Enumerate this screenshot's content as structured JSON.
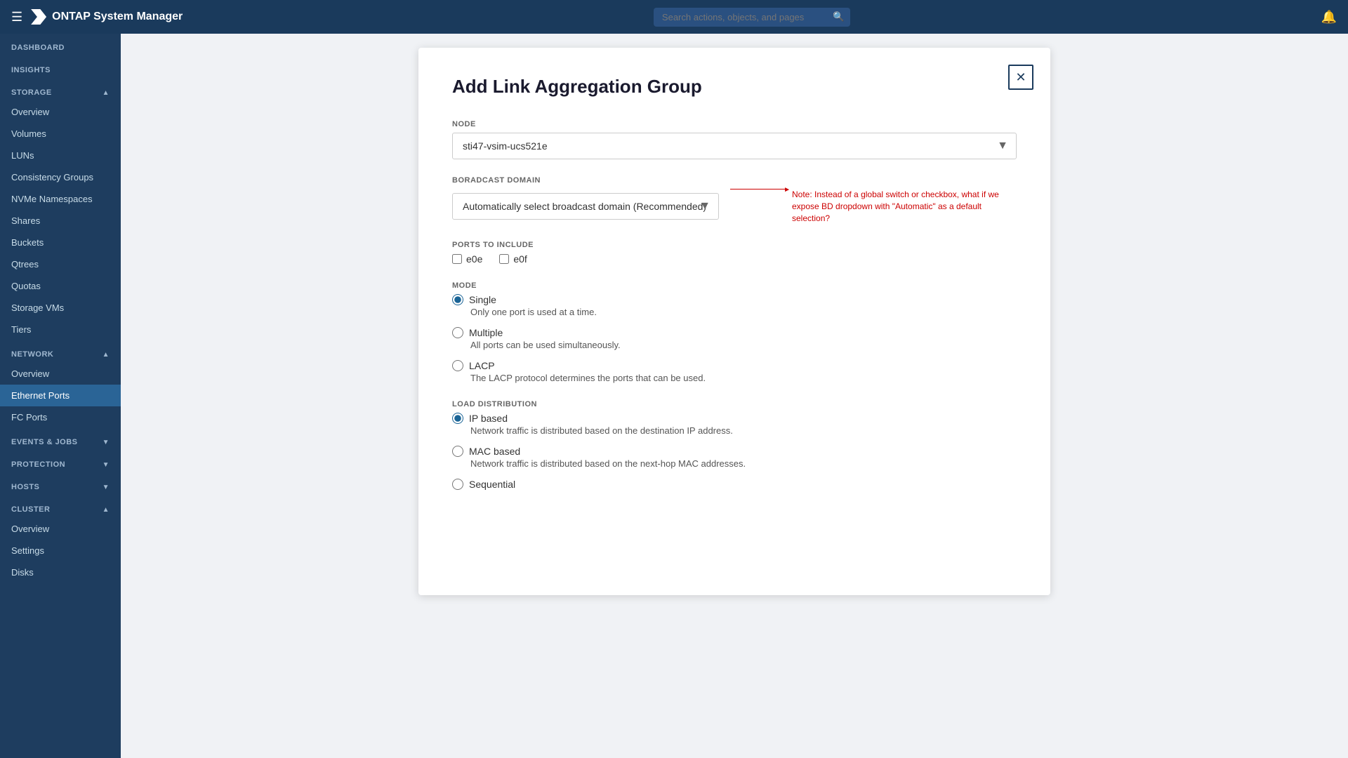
{
  "navbar": {
    "title": "ONTAP System Manager",
    "search_placeholder": "Search actions, objects, and pages"
  },
  "sidebar": {
    "sections": [
      {
        "id": "dashboard",
        "label": "DASHBOARD",
        "type": "top-link",
        "active": false
      },
      {
        "id": "insights",
        "label": "INSIGHTS",
        "type": "top-link",
        "active": false
      },
      {
        "id": "storage",
        "label": "STORAGE",
        "type": "section",
        "expanded": true,
        "items": [
          {
            "id": "overview-storage",
            "label": "Overview",
            "active": false
          },
          {
            "id": "volumes",
            "label": "Volumes",
            "active": false
          },
          {
            "id": "luns",
            "label": "LUNs",
            "active": false
          },
          {
            "id": "consistency-groups",
            "label": "Consistency Groups",
            "active": false
          },
          {
            "id": "nvme-namespaces",
            "label": "NVMe Namespaces",
            "active": false
          },
          {
            "id": "shares",
            "label": "Shares",
            "active": false
          },
          {
            "id": "buckets",
            "label": "Buckets",
            "active": false
          },
          {
            "id": "qtrees",
            "label": "Qtrees",
            "active": false
          },
          {
            "id": "quotas",
            "label": "Quotas",
            "active": false
          },
          {
            "id": "storage-vms",
            "label": "Storage VMs",
            "active": false
          },
          {
            "id": "tiers",
            "label": "Tiers",
            "active": false
          }
        ]
      },
      {
        "id": "network",
        "label": "NETWORK",
        "type": "section",
        "expanded": true,
        "items": [
          {
            "id": "overview-network",
            "label": "Overview",
            "active": false
          },
          {
            "id": "ethernet-ports",
            "label": "Ethernet Ports",
            "active": true
          },
          {
            "id": "fc-ports",
            "label": "FC Ports",
            "active": false
          }
        ]
      },
      {
        "id": "events-jobs",
        "label": "EVENTS & JOBS",
        "type": "section",
        "expanded": true,
        "items": []
      },
      {
        "id": "protection",
        "label": "PROTECTION",
        "type": "section",
        "expanded": true,
        "items": []
      },
      {
        "id": "hosts",
        "label": "HOSTS",
        "type": "section",
        "expanded": true,
        "items": []
      },
      {
        "id": "cluster",
        "label": "CLUSTER",
        "type": "section",
        "expanded": true,
        "items": [
          {
            "id": "overview-cluster",
            "label": "Overview",
            "active": false
          },
          {
            "id": "settings",
            "label": "Settings",
            "active": false
          },
          {
            "id": "disks",
            "label": "Disks",
            "active": false
          }
        ]
      }
    ]
  },
  "modal": {
    "title": "Add Link Aggregation Group",
    "close_label": "✕",
    "node_label": "NODE",
    "node_value": "sti47-vsim-ucs521e",
    "node_options": [
      "sti47-vsim-ucs521e"
    ],
    "broadcast_domain_label": "BORADCAST DOMAIN",
    "broadcast_domain_value": "Automatically select broadcast domain (Recommended)",
    "broadcast_domain_options": [
      "Automatically select broadcast domain (Recommended)"
    ],
    "broadcast_note": "Note: Instead of a global switch or checkbox, what if we expose BD dropdown with \"Automatic\" as a default selection?",
    "ports_label": "PORTS TO INCLUDE",
    "ports": [
      {
        "id": "e0e",
        "label": "e0e",
        "checked": false
      },
      {
        "id": "e0f",
        "label": "e0f",
        "checked": false
      }
    ],
    "mode_label": "MODE",
    "modes": [
      {
        "id": "single",
        "label": "Single",
        "desc": "Only one port is used at a time.",
        "checked": true
      },
      {
        "id": "multiple",
        "label": "Multiple",
        "desc": "All ports can be used simultaneously.",
        "checked": false
      },
      {
        "id": "lacp",
        "label": "LACP",
        "desc": "The LACP protocol determines the ports that can be used.",
        "checked": false
      }
    ],
    "load_dist_label": "LOAD DISTRIBUTION",
    "load_distributions": [
      {
        "id": "ip-based",
        "label": "IP based",
        "desc": "Network traffic is distributed based on the destination IP address.",
        "checked": true
      },
      {
        "id": "mac-based",
        "label": "MAC based",
        "desc": "Network traffic is distributed based on the next-hop MAC addresses.",
        "checked": false
      },
      {
        "id": "sequential",
        "label": "Sequential",
        "desc": "",
        "checked": false
      }
    ]
  }
}
